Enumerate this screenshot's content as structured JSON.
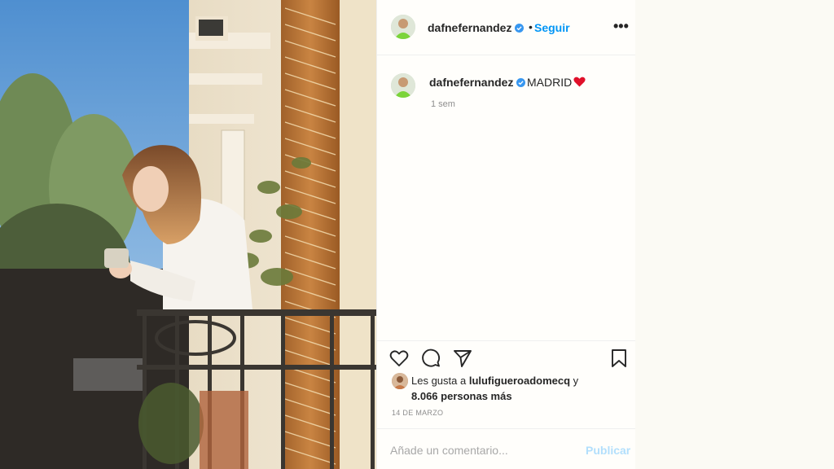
{
  "post": {
    "username": "dafnefernandez",
    "follow_separator": "•",
    "follow_label": "Seguir",
    "more_label": "•••",
    "caption_text": "MADRID",
    "caption_time": "1 sem",
    "likes_prefix": "Les gusta a ",
    "likes_user": "lulufigueroadomecq",
    "likes_suffix": " y",
    "likes_count": "8.066 personas más",
    "date": "14 DE MARZO",
    "comment_placeholder": "Añade un comentario...",
    "publish_label": "Publicar"
  },
  "colors": {
    "link_blue": "#0095f6",
    "publish_disabled": "#b2dffc",
    "verified_blue": "#3897f0",
    "heart_red": "#e0102a"
  },
  "icons": [
    "heart-icon",
    "comment-icon",
    "share-icon",
    "bookmark-icon",
    "verified-icon",
    "red-heart-emoji"
  ]
}
